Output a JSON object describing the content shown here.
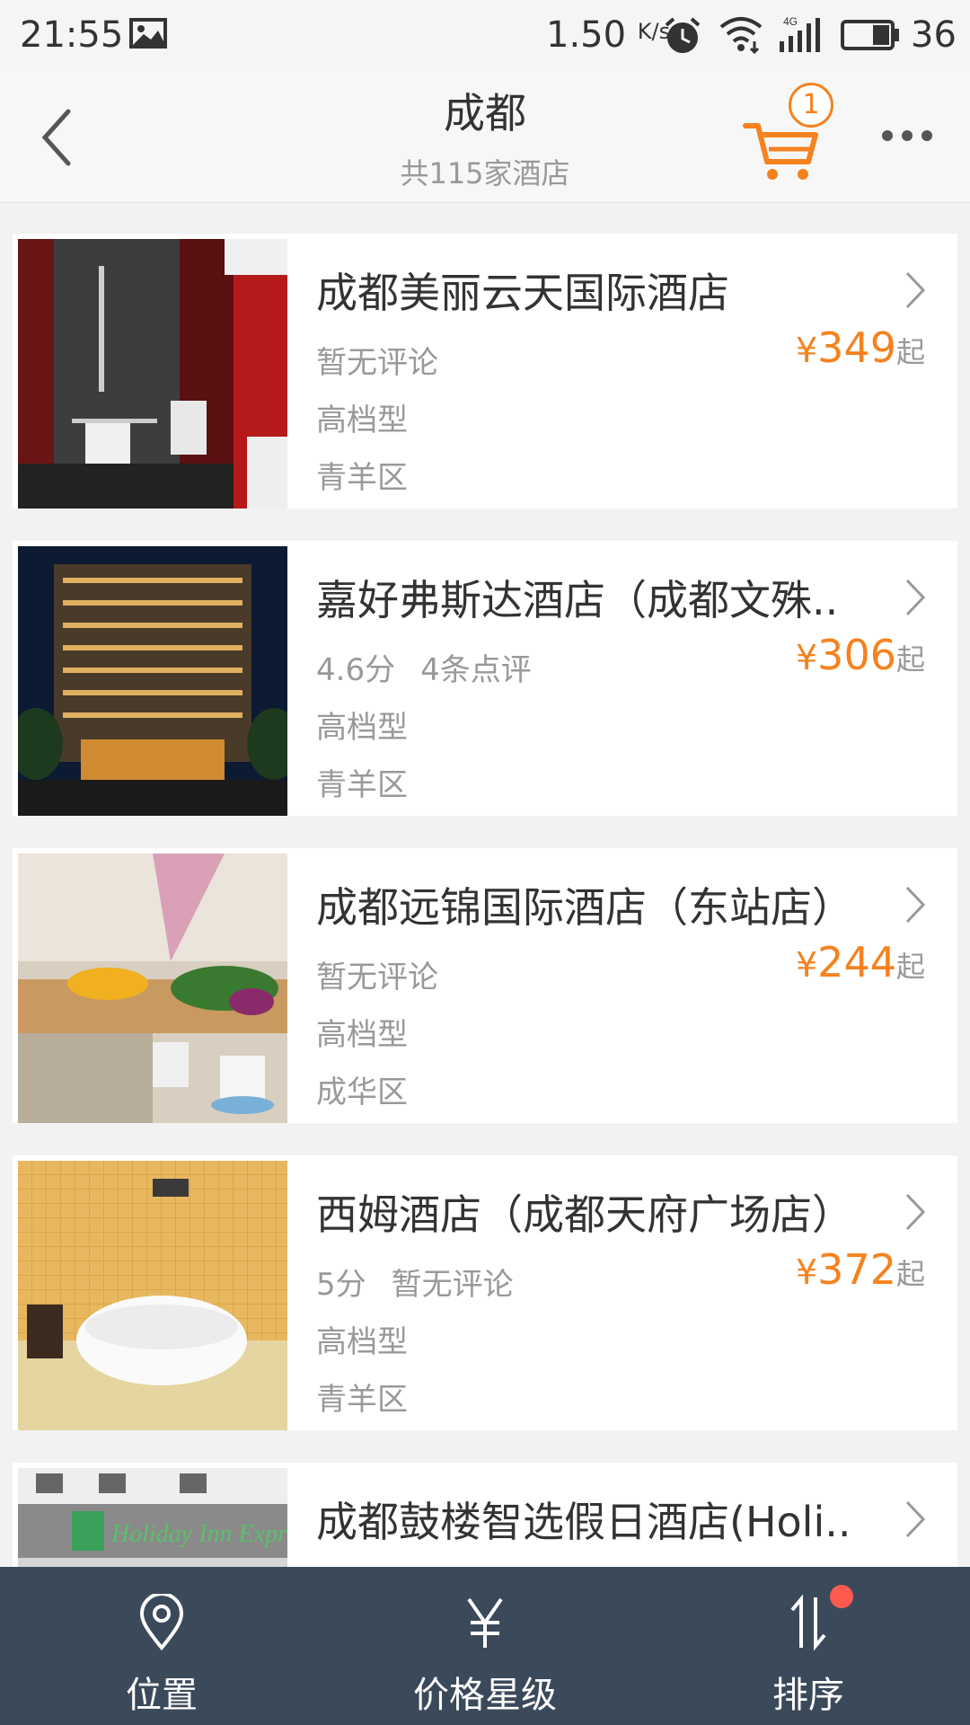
{
  "status_bar": {
    "time": "21:55",
    "net_speed": "1.50",
    "net_speed_unit": "K/s",
    "battery_percent": "36",
    "network_label": "4G"
  },
  "header": {
    "back_icon": "chevron-left-icon",
    "title": "成都",
    "subtitle": "共115家酒店",
    "cart_icon": "shopping-cart-icon",
    "cart_count": "1",
    "more_icon": "more-dots-icon"
  },
  "hotels": [
    {
      "name": "成都美丽云天国际酒店",
      "score": "",
      "reviews": "暂无评论",
      "price": "349",
      "currency": "¥",
      "price_suffix": "起",
      "tier": "高档型",
      "district": "青羊区"
    },
    {
      "name": "嘉好弗斯达酒店（成都文殊..",
      "score": "4.6分",
      "reviews": "4条点评",
      "price": "306",
      "currency": "¥",
      "price_suffix": "起",
      "tier": "高档型",
      "district": "青羊区"
    },
    {
      "name": "成都远锦国际酒店（东站店）",
      "score": "",
      "reviews": "暂无评论",
      "price": "244",
      "currency": "¥",
      "price_suffix": "起",
      "tier": "高档型",
      "district": "成华区"
    },
    {
      "name": "西姆酒店（成都天府广场店）",
      "score": "5分",
      "reviews": "暂无评论",
      "price": "372",
      "currency": "¥",
      "price_suffix": "起",
      "tier": "高档型",
      "district": "青羊区"
    },
    {
      "name": "成都鼓楼智选假日酒店(Holi..",
      "score": "",
      "reviews": "",
      "price": "",
      "currency": "",
      "price_suffix": "",
      "tier": "",
      "district": ""
    }
  ],
  "bottom_bar": {
    "tabs": [
      {
        "label": "位置",
        "icon": "location-pin-icon"
      },
      {
        "label": "价格星级",
        "icon": "yen-icon"
      },
      {
        "label": "排序",
        "icon": "sort-arrows-icon"
      }
    ]
  },
  "colors": {
    "accent": "#f5821f",
    "bottom_bar_bg": "#3b4a5a",
    "notification_dot": "#ff5a4f"
  }
}
